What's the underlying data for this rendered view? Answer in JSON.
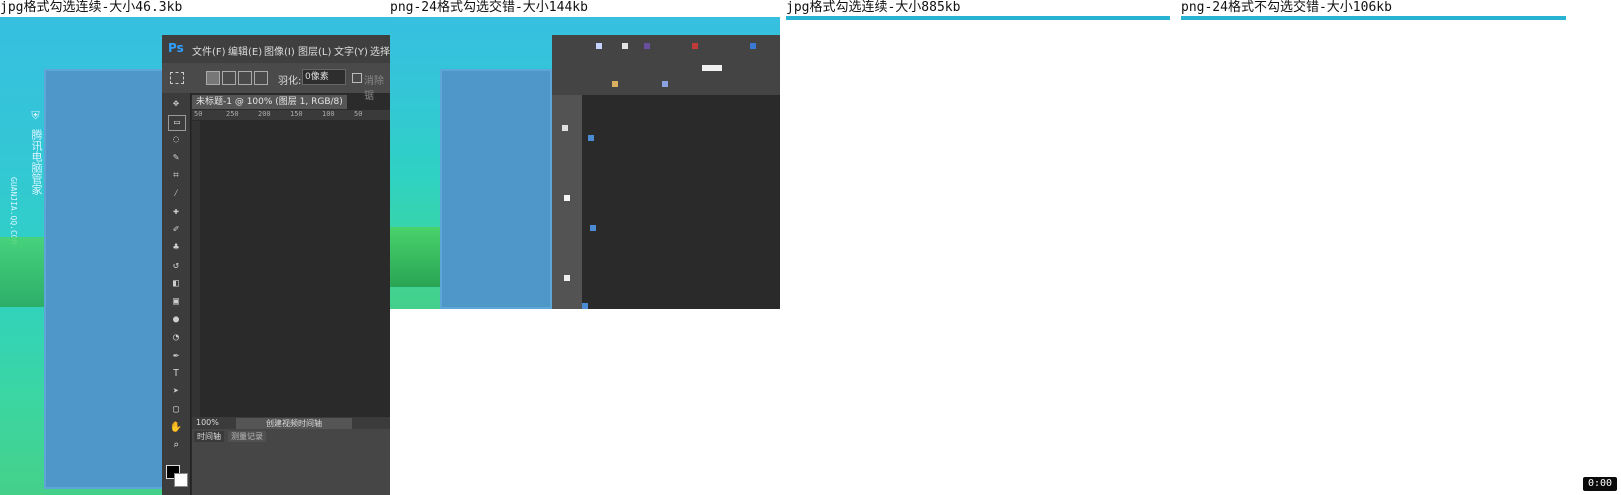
{
  "panels": [
    {
      "caption": "jpg格式勾选连续-大小46.3kb"
    },
    {
      "caption": "png-24格式勾选交错-大小144kb"
    },
    {
      "caption": "jpg格式勾选连续-大小885kb"
    },
    {
      "caption": "png-24格式不勾选交错-大小106kb"
    }
  ],
  "ps": {
    "logo": "Ps",
    "menus": [
      "文件(F)",
      "编辑(E)",
      "图像(I)",
      "图层(L)",
      "文字(Y)",
      "选择"
    ],
    "feather_label": "羽化:",
    "feather_value": "0像素",
    "antialias_label": "消除锯",
    "doc_tab": "未标题-1 @ 100% (图层 1, RGB/8)",
    "zoom": "100%",
    "ruler_ticks": [
      "50",
      "250",
      "200",
      "150",
      "100",
      "50"
    ],
    "timeline_button": "创建视频时间轴",
    "timeline_tab_1": "时间轴",
    "timeline_tab_2": "测量记录"
  },
  "brand": {
    "name": "腾讯电脑管家",
    "site": "GUANJIA.QQ.COM"
  },
  "timer": "0:00"
}
